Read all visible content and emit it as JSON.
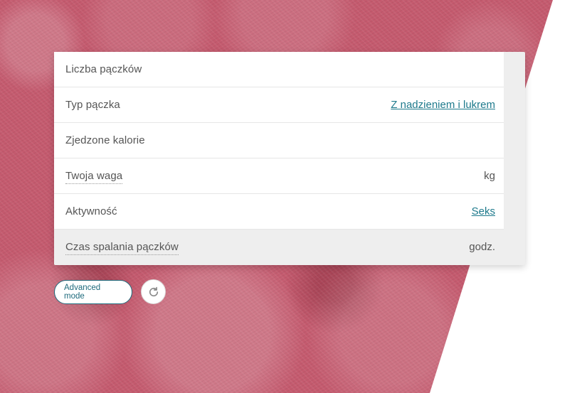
{
  "calculator": {
    "rows": [
      {
        "label": "Liczba pączków",
        "value": "",
        "unit": ""
      },
      {
        "label": "Typ pączka",
        "value": "Z nadzieniem i lukrem",
        "unit": ""
      },
      {
        "label": "Zjedzone kalorie",
        "value": "",
        "unit": ""
      },
      {
        "label": "Twoja waga",
        "value": "",
        "unit": "kg"
      },
      {
        "label": "Aktywność",
        "value": "Seks",
        "unit": ""
      },
      {
        "label": "Czas spalania pączków",
        "value": "",
        "unit": "godz."
      }
    ]
  },
  "controls": {
    "advanced_mode_label": "Advanced mode",
    "reset_icon": "refresh-icon"
  },
  "colors": {
    "accent": "#1e7a8c",
    "background_pink": "#c45a6e",
    "panel_gray": "#eeeeee"
  }
}
